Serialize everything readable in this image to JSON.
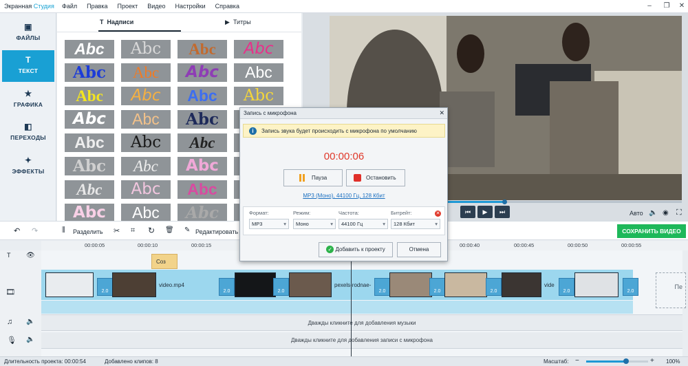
{
  "app": {
    "title_a": "Экранная ",
    "title_b": "Студия"
  },
  "menu": [
    "Файл",
    "Правка",
    "Проект",
    "Видео",
    "Настройки",
    "Справка"
  ],
  "tools": [
    {
      "label": "ФАЙЛЫ",
      "icon": "image-icon"
    },
    {
      "label": "ТЕКСТ",
      "icon": "text-icon"
    },
    {
      "label": "ГРАФИКА",
      "icon": "star-icon"
    },
    {
      "label": "ПЕРЕХОДЫ",
      "icon": "transitions-icon"
    },
    {
      "label": "ЭФФЕКТЫ",
      "icon": "magic-wand-icon"
    }
  ],
  "panel": {
    "tab1": "Надписи",
    "tab2": "Титры",
    "tile_text": "Abc"
  },
  "toolbar": {
    "split": "Разделить",
    "edit": "Редактировать",
    "save": "СОХРАНИТЬ ВИДЕО"
  },
  "preview": {
    "auto": "Авто"
  },
  "ruler": [
    "00:00:05",
    "00:00:10",
    "00:00:15",
    "00:00:40",
    "00:00:45",
    "00:00:50",
    "00:00:55"
  ],
  "timeline": {
    "text_clip": "Соз",
    "clip1": "video.mp4",
    "clip2": "pexels-rodnae-",
    "clip3": "vide",
    "trans": "2.0",
    "next_slot": "Пе",
    "music_hint": "Дважды кликните для добавления музыки",
    "mic_hint": "Дважды кликните для добавления записи с микрофона"
  },
  "status": {
    "duration": "Длительность проекта: 00:00:54",
    "clips": "Добавлено клипов: 8",
    "zoom_label": "Масштаб:",
    "zoom_value": "100%"
  },
  "dialog": {
    "title": "Запись с микрофона",
    "notice": "Запись звука будет происходить с микрофона по умолчанию",
    "timer": "00:00:06",
    "pause": "Пауза",
    "stop": "Остановить",
    "link": "MP3 (Моно), 44100 Гц, 128 Кбит",
    "format_label": "Формат:",
    "format": "MP3",
    "mode_label": "Режим:",
    "mode": "Моно",
    "freq_label": "Частота:",
    "freq": "44100 Гц",
    "bitrate_label": "Битрейт:",
    "bitrate": "128 Кбит",
    "add": "Добавить к проекту",
    "cancel": "Отмена"
  },
  "colors": {
    "accent": "#19a0d4",
    "save_green": "#1eb85a",
    "timer_red": "#e0392b"
  }
}
